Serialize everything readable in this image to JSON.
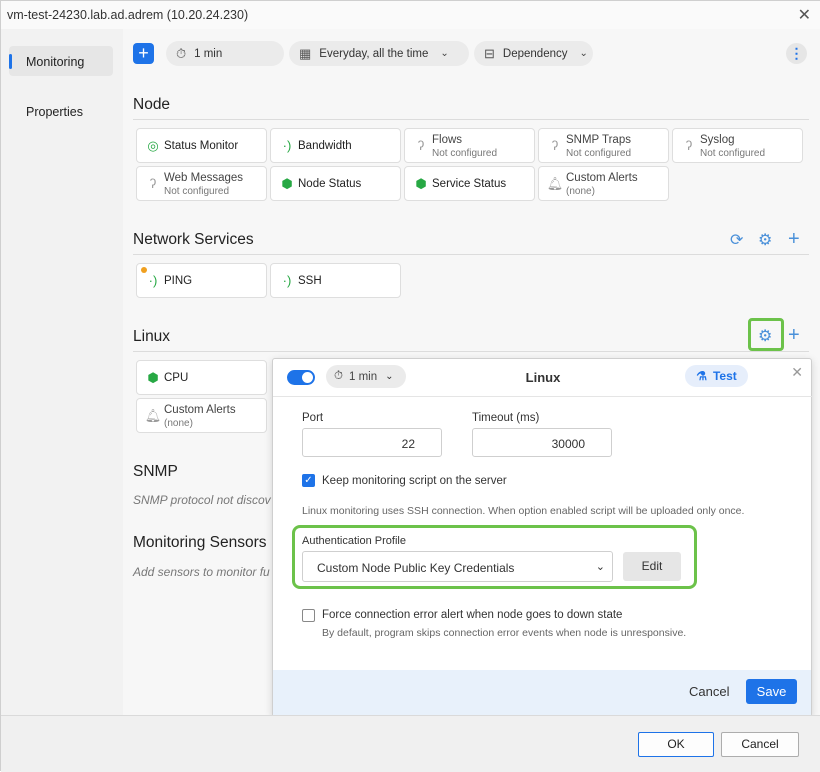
{
  "window": {
    "title": "vm-test-24230.lab.ad.adrem (10.20.24.230)"
  },
  "sidebar": {
    "items": [
      {
        "label": "Monitoring"
      },
      {
        "label": "Properties"
      }
    ]
  },
  "toolbar": {
    "interval": "1 min",
    "schedule": "Everyday, all the time",
    "dependency": "Dependency"
  },
  "sections": {
    "node": {
      "title": "Node",
      "tiles": [
        {
          "name": "Status Monitor",
          "sub": ""
        },
        {
          "name": "Bandwidth",
          "sub": ""
        },
        {
          "name": "Flows",
          "sub": "Not configured"
        },
        {
          "name": "SNMP Traps",
          "sub": "Not configured"
        },
        {
          "name": "Syslog",
          "sub": "Not configured"
        },
        {
          "name": "Web Messages",
          "sub": "Not configured"
        },
        {
          "name": "Node Status",
          "sub": ""
        },
        {
          "name": "Service Status",
          "sub": ""
        },
        {
          "name": "Custom Alerts",
          "sub": "(none)"
        }
      ]
    },
    "network": {
      "title": "Network Services",
      "tiles": [
        {
          "name": "PING"
        },
        {
          "name": "SSH"
        }
      ]
    },
    "linux": {
      "title": "Linux",
      "tiles": [
        {
          "name": "CPU",
          "sub": ""
        },
        {
          "name": "Custom Alerts",
          "sub": "(none)"
        }
      ]
    },
    "snmp": {
      "title": "SNMP",
      "text": "SNMP protocol not discov"
    },
    "sensors": {
      "title": "Monitoring Sensors",
      "text": "Add sensors to monitor fu"
    }
  },
  "popup": {
    "interval": "1 min",
    "title": "Linux",
    "test_label": "Test",
    "port_label": "Port",
    "port_value": "22",
    "timeout_label": "Timeout (ms)",
    "timeout_value": "30000",
    "keep_script_label": "Keep monitoring script on the server",
    "keep_script_checked": true,
    "ssh_note": "Linux monitoring uses SSH connection. When option enabled script will be uploaded only once.",
    "auth_label": "Authentication Profile",
    "auth_value": "Custom Node Public Key Credentials",
    "edit_label": "Edit",
    "force_label": "Force connection error alert when node goes to down state",
    "force_checked": false,
    "force_note": "By default, program skips connection error events when node is unresponsive.",
    "cancel_label": "Cancel",
    "save_label": "Save"
  },
  "dialog": {
    "ok_label": "OK",
    "cancel_label": "Cancel"
  },
  "colors": {
    "accent": "#1e73e8",
    "highlight": "#6cc24a",
    "ok_green": "#27a844",
    "warning_dot": "#f0a020"
  }
}
